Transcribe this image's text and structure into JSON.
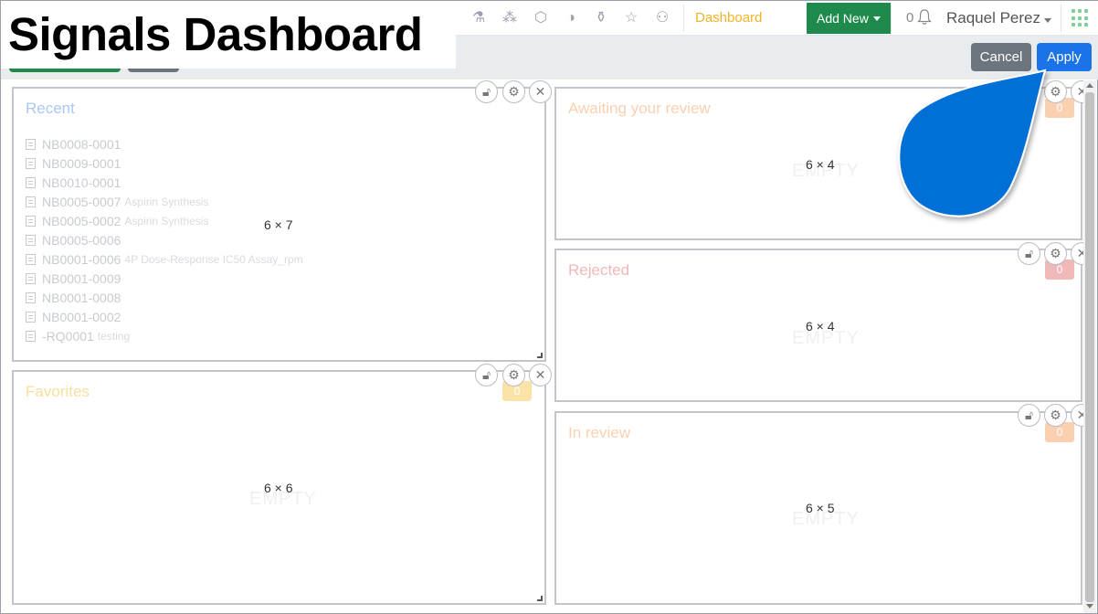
{
  "title": "Signals Dashboard",
  "nav": {
    "icons": [
      "flask-rack-icon",
      "molecule-icon",
      "hexagon-icon",
      "shield-icon",
      "flask-icon",
      "star-icon",
      "user-icon"
    ],
    "dashboard_label": "Dashboard",
    "add_new_label": "Add New",
    "notification_count": "0",
    "user_name": "Raquel Perez"
  },
  "toolbar": {
    "cancel_label": "Cancel",
    "apply_label": "Apply"
  },
  "panels": {
    "recent": {
      "title": "Recent",
      "size": "6 × 7",
      "items": [
        {
          "id": "NB0008-0001",
          "desc": ""
        },
        {
          "id": "NB0009-0001",
          "desc": ""
        },
        {
          "id": "NB0010-0001",
          "desc": ""
        },
        {
          "id": "NB0005-0007",
          "desc": "Aspirin Synthesis"
        },
        {
          "id": "NB0005-0002",
          "desc": "Aspirin Synthesis"
        },
        {
          "id": "NB0005-0006",
          "desc": ""
        },
        {
          "id": "NB0001-0006",
          "desc": "4P Dose-Response IC50 Assay_rpm"
        },
        {
          "id": "NB0001-0009",
          "desc": ""
        },
        {
          "id": "NB0001-0008",
          "desc": ""
        },
        {
          "id": "NB0001-0002",
          "desc": ""
        },
        {
          "id": "-RQ0001",
          "desc": "testing"
        }
      ]
    },
    "favorites": {
      "title": "Favorites",
      "size": "6 × 6",
      "empty": "EMPTY",
      "badge": "0"
    },
    "awaiting": {
      "title": "Awaiting your review",
      "size": "6 × 4",
      "empty": "EMPTY",
      "badge": "0"
    },
    "rejected": {
      "title": "Rejected",
      "size": "6 × 4",
      "empty": "EMPTY",
      "badge": "0"
    },
    "in_review": {
      "title": "In review",
      "size": "6 × 5",
      "empty": "EMPTY",
      "badge": "0"
    }
  },
  "colors": {
    "recent_title": "#a9c8f5",
    "favorites_title": "#f7dfa0",
    "awaiting_title": "#fbd0b0",
    "rejected_title": "#f0b8b8",
    "in_review_title": "#fbd0b0",
    "accent": "#1a73e8",
    "callout": "#0070d6"
  }
}
